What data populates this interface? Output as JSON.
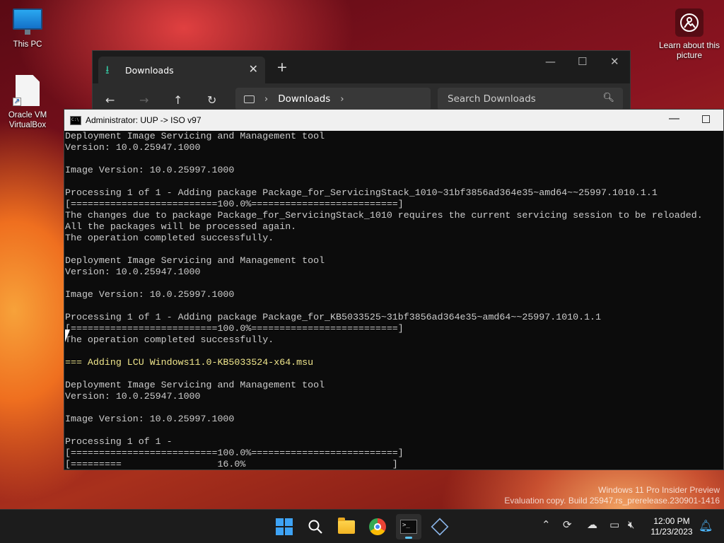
{
  "desktop": {
    "icons": [
      {
        "label": "This PC"
      },
      {
        "label": "Oracle VM VirtualBox"
      }
    ],
    "learn_about": "Learn about this picture",
    "watermark": {
      "line1": "Windows 11 Pro Insider Preview",
      "line2": "Evaluation copy. Build 25947.rs_prerelease.230901-1416"
    }
  },
  "explorer": {
    "tab_title": "Downloads",
    "address": {
      "segment": "Downloads"
    },
    "search_placeholder": "Search Downloads"
  },
  "console": {
    "title": "Administrator:  UUP -> ISO v97",
    "lines": [
      {
        "text": "Deployment Image Servicing and Management tool",
        "color": "#cccccc"
      },
      {
        "text": "Version: 10.0.25947.1000",
        "color": "#cccccc"
      },
      {
        "text": "",
        "color": "#cccccc"
      },
      {
        "text": "Image Version: 10.0.25997.1000",
        "color": "#cccccc"
      },
      {
        "text": "",
        "color": "#cccccc"
      },
      {
        "text": "Processing 1 of 1 - Adding package Package_for_ServicingStack_1010~31bf3856ad364e35~amd64~~25997.1010.1.1",
        "color": "#cccccc"
      },
      {
        "text": "[==========================100.0%==========================]",
        "color": "#cccccc"
      },
      {
        "text": "The changes due to package Package_for_ServicingStack_1010 requires the current servicing session to be reloaded.",
        "color": "#cccccc"
      },
      {
        "text": "All the packages will be processed again.",
        "color": "#cccccc"
      },
      {
        "text": "The operation completed successfully.",
        "color": "#cccccc"
      },
      {
        "text": "",
        "color": "#cccccc"
      },
      {
        "text": "Deployment Image Servicing and Management tool",
        "color": "#cccccc"
      },
      {
        "text": "Version: 10.0.25947.1000",
        "color": "#cccccc"
      },
      {
        "text": "",
        "color": "#cccccc"
      },
      {
        "text": "Image Version: 10.0.25997.1000",
        "color": "#cccccc"
      },
      {
        "text": "",
        "color": "#cccccc"
      },
      {
        "text": "Processing 1 of 1 - Adding package Package_for_KB5033525~31bf3856ad364e35~amd64~~25997.1010.1.1",
        "color": "#cccccc"
      },
      {
        "text": "[==========================100.0%==========================]",
        "color": "#cccccc"
      },
      {
        "text": "The operation completed successfully.",
        "color": "#cccccc"
      },
      {
        "text": "",
        "color": "#cccccc"
      },
      {
        "text": "=== Adding LCU Windows11.0-KB5033524-x64.msu",
        "color": "#f0e68c"
      },
      {
        "text": "",
        "color": "#cccccc"
      },
      {
        "text": "Deployment Image Servicing and Management tool",
        "color": "#cccccc"
      },
      {
        "text": "Version: 10.0.25947.1000",
        "color": "#cccccc"
      },
      {
        "text": "",
        "color": "#cccccc"
      },
      {
        "text": "Image Version: 10.0.25997.1000",
        "color": "#cccccc"
      },
      {
        "text": "",
        "color": "#cccccc"
      },
      {
        "text": "Processing 1 of 1 -",
        "color": "#cccccc"
      },
      {
        "text": "[==========================100.0%==========================]",
        "color": "#cccccc"
      },
      {
        "text": "[=========                 16.0%                          ]",
        "color": "#cccccc"
      }
    ]
  },
  "taskbar": {
    "clock_time": "12:00 PM",
    "clock_date": "11/23/2023",
    "accent": "#5cc8ff"
  }
}
